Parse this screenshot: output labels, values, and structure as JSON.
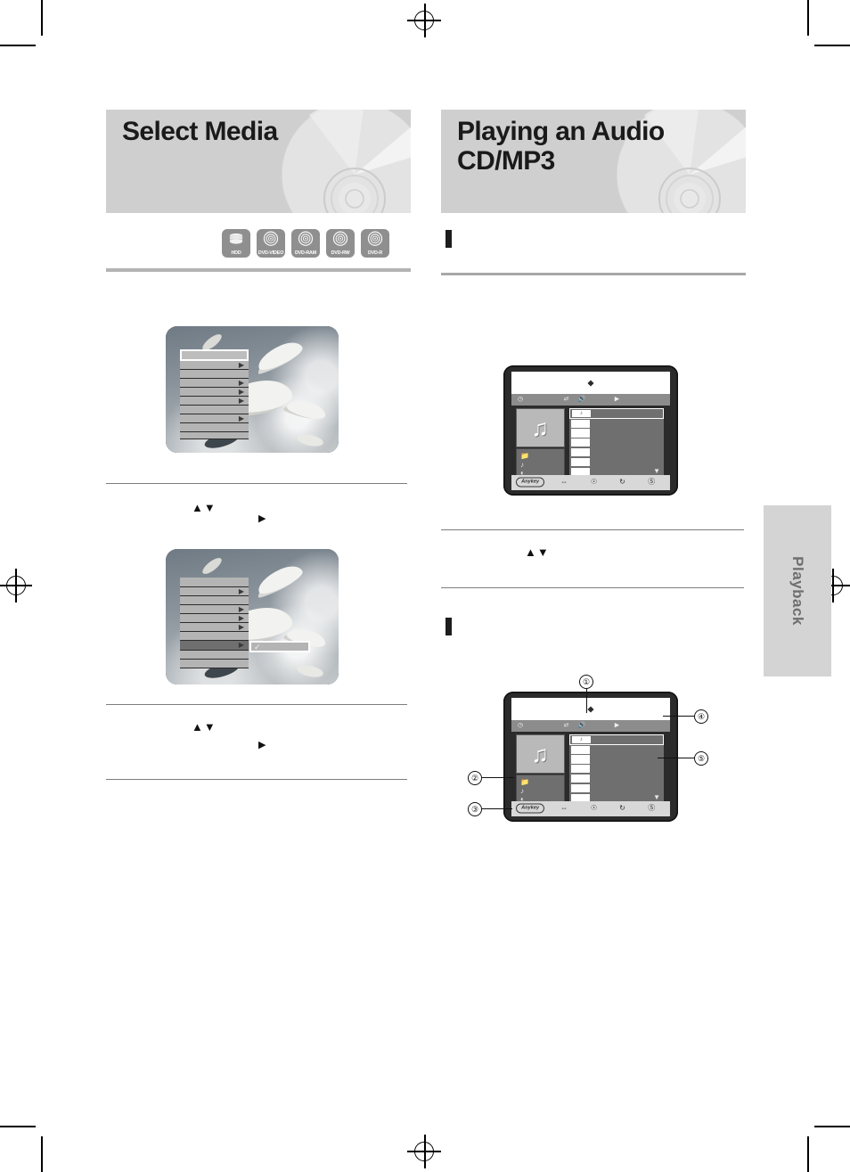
{
  "page": {
    "side_tab_label": "Playback",
    "left_column": {
      "banner_title": "Select Media",
      "disc_badges": [
        {
          "label": "HDD",
          "icon": "hdd-stack-icon"
        },
        {
          "label": "DVD-VIDEO",
          "icon": "disc-icon"
        },
        {
          "label": "DVD-RAM",
          "icon": "disc-icon"
        },
        {
          "label": "DVD-RW",
          "icon": "disc-icon"
        },
        {
          "label": "DVD-R",
          "icon": "disc-icon"
        }
      ],
      "figure_1": {
        "name": "tv-osd-menu-screenshot",
        "rows": [
          {
            "selected": true,
            "has_arrow": false
          },
          {
            "selected": false,
            "has_arrow": true
          },
          {
            "selected": false,
            "has_arrow": false
          },
          {
            "selected": false,
            "has_arrow": true
          },
          {
            "selected": false,
            "has_arrow": true
          },
          {
            "selected": false,
            "has_arrow": true
          },
          {
            "selected": false,
            "has_arrow": false
          },
          {
            "selected": false,
            "has_arrow": true
          },
          {
            "selected": false,
            "has_arrow": false
          },
          {
            "selected": false,
            "has_arrow": false
          }
        ]
      },
      "step_glyphs_1": {
        "updown": "▲▼",
        "right": "▶"
      },
      "figure_2": {
        "name": "tv-osd-submenu-screenshot",
        "highlighted_row_index": 7,
        "submenu_check": "✓",
        "rows": [
          {
            "selected": false,
            "has_arrow": false
          },
          {
            "selected": false,
            "has_arrow": true
          },
          {
            "selected": false,
            "has_arrow": false
          },
          {
            "selected": false,
            "has_arrow": true
          },
          {
            "selected": false,
            "has_arrow": true
          },
          {
            "selected": false,
            "has_arrow": true
          },
          {
            "selected": false,
            "has_arrow": false
          },
          {
            "selected": false,
            "has_arrow": true
          },
          {
            "selected": false,
            "has_arrow": false
          },
          {
            "selected": false,
            "has_arrow": false
          }
        ]
      },
      "step_glyphs_2": {
        "updown": "▲▼",
        "right": "▶"
      }
    },
    "right_column": {
      "banner_title": "Playing an Audio\nCD/MP3",
      "section_1": {
        "marker": true,
        "title": ""
      },
      "section_2": {
        "marker": true,
        "title": ""
      },
      "step_glyphs_1": {
        "updown": "▲▼"
      },
      "player_ui": {
        "name": "audio-cd-mp3-player-screen",
        "titlebar_marker": "◆",
        "toolbar_icons": [
          "clock-icon",
          "shuffle-icon",
          "speaker-icon",
          "play-icon"
        ],
        "artwork_icon": "music-note-icon",
        "sidebar_icons": [
          "folder-icon",
          "music-file-icon",
          "disc-pie-icon"
        ],
        "list_rows": 7,
        "list_first_row_icon": "music-note-icon",
        "scroll_down_icon": "▼",
        "button_bar": {
          "anykey_label": "Anykey",
          "icons": [
            "zoom-icon",
            "repeat-icon",
            "rotate-icon",
            "info-icon"
          ]
        }
      },
      "player_ui_callouts": {
        "name": "audio-cd-mp3-player-screen-annotated",
        "markers": [
          "①",
          "②",
          "③",
          "④",
          "⑤"
        ]
      }
    }
  },
  "colors": {
    "banner_bg": "#cfcfcf",
    "badge_bg": "#8f8f8f",
    "rule": "#b3b3b3",
    "sidetab_bg": "#d4d4d4",
    "sidetab_text": "#6f6f6f",
    "ui_body": "#2b2b2b",
    "ui_panel": "#6f6f6f",
    "ui_toolbar": "#8c8c8c",
    "ui_buttonbar": "#d8d8d8"
  }
}
